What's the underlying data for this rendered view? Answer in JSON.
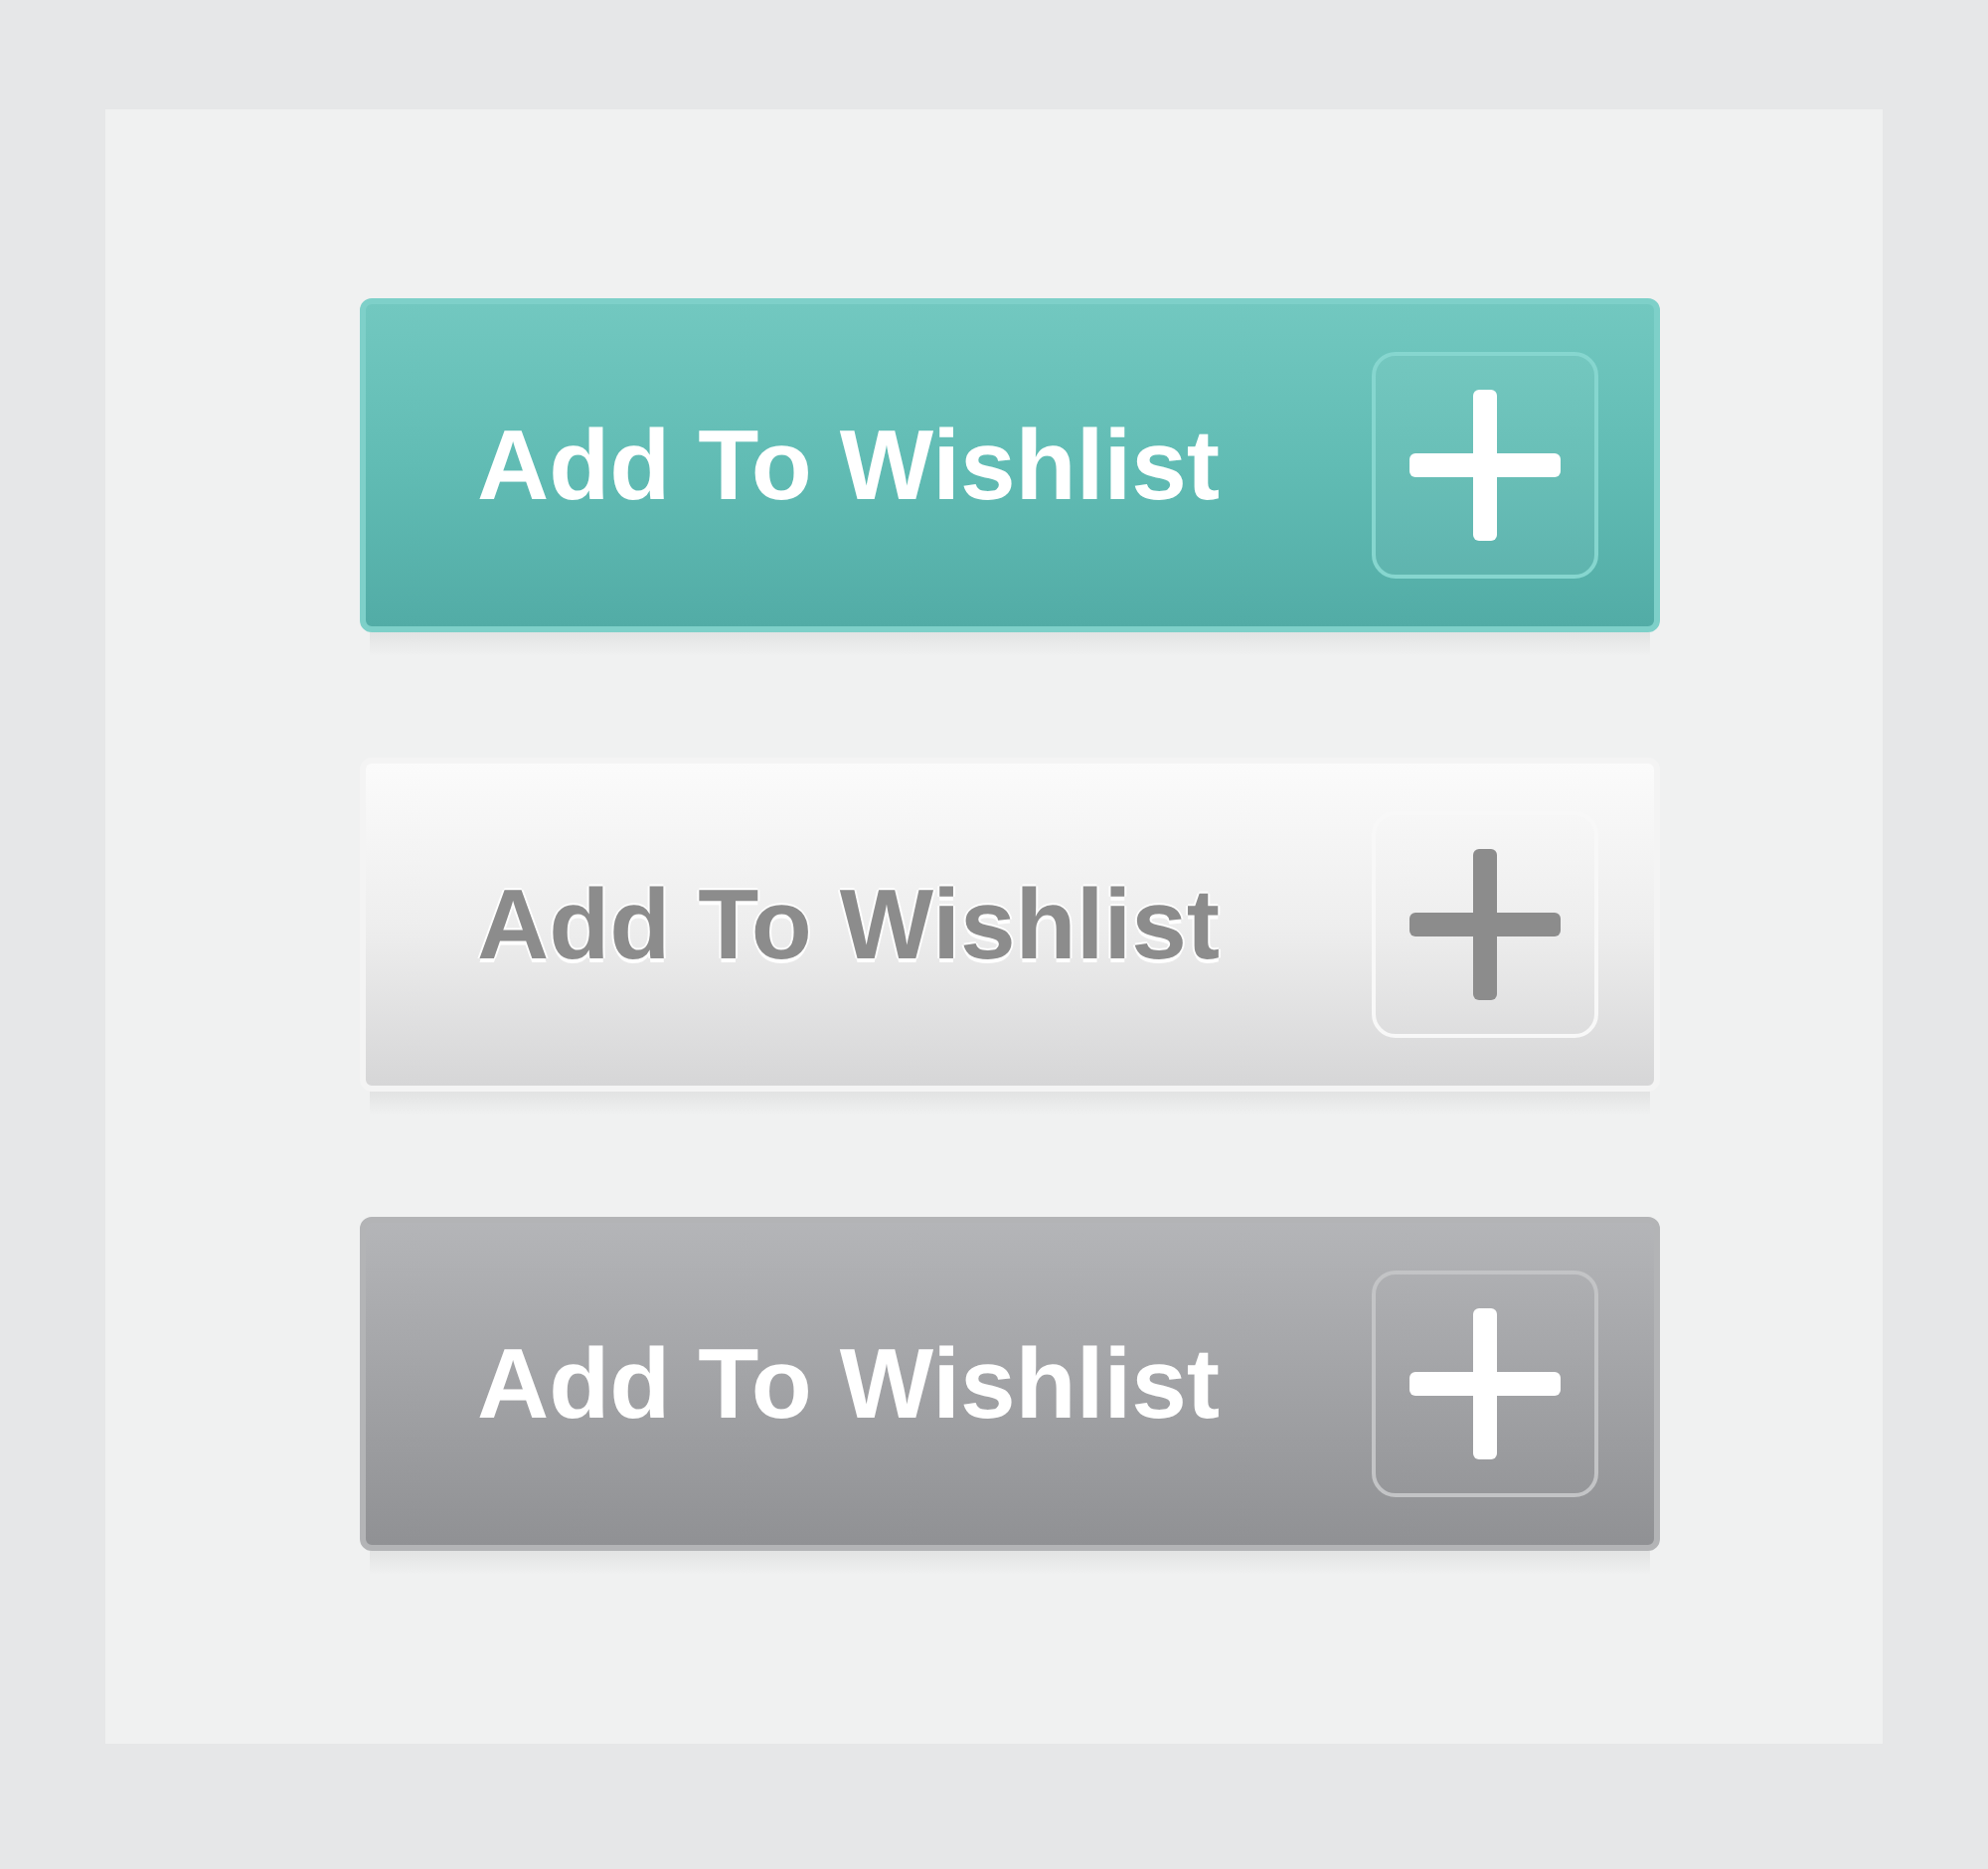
{
  "buttons": [
    {
      "label": "Add To Wishlist",
      "kind": "teal"
    },
    {
      "label": "Add To Wishlist",
      "kind": "light"
    },
    {
      "label": "Add To Wishlist",
      "kind": "grey"
    }
  ]
}
